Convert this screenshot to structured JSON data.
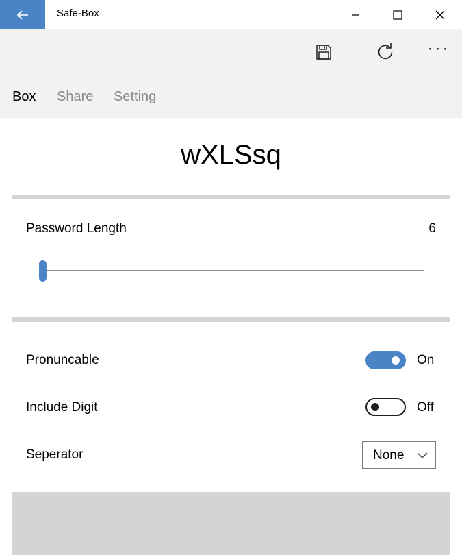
{
  "window": {
    "title": "Safe-Box",
    "back_icon": "arrow-left-icon",
    "controls": [
      "minimize-icon",
      "maximize-icon",
      "close-icon"
    ]
  },
  "commandbar": {
    "icons": [
      "save-icon",
      "refresh-icon",
      "more-icon"
    ],
    "more_label": "···"
  },
  "tabs": [
    {
      "label": "Box",
      "active": true
    },
    {
      "label": "Share",
      "active": false
    },
    {
      "label": "Setting",
      "active": false
    }
  ],
  "generated_password": "wXLSsq",
  "password_length": {
    "label": "Password Length",
    "value": "6",
    "slider_level": 0.0
  },
  "options": {
    "pronouncable": {
      "label": "Pronuncable",
      "state": "On"
    },
    "include_digit": {
      "label": "Include Digit",
      "state": "Off"
    },
    "separator": {
      "label": "Seperator",
      "value": "None"
    }
  },
  "colors": {
    "accent": "#4a83c6",
    "command_bar_bg": "#f2f2f2",
    "divider": "#d4d4d4"
  }
}
